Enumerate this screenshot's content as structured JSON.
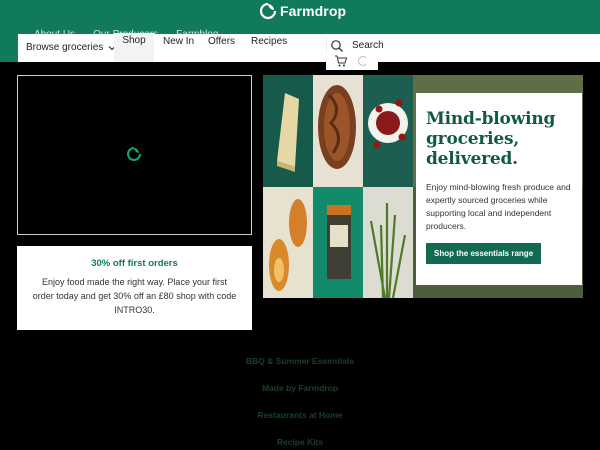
{
  "header": {
    "brand": "Farmdrop",
    "ghost_nav": [
      "About Us",
      "Our Producers",
      "Farmblog"
    ],
    "browse_label": "Browse groceries",
    "shop_label": "Shop",
    "menu": [
      "New In",
      "Offers",
      "Recipes"
    ],
    "search_label": "Search",
    "colors": {
      "brand_green": "#117a5d",
      "button_green": "#126a52"
    }
  },
  "promo": {
    "title": "30% off first orders",
    "body": "Enjoy food made the right way. Place your first order today and get 30% off an £80 shop with code INTRO30."
  },
  "hero": {
    "title": "Mind-blowing groceries, delivered.",
    "text": "Enjoy mind-blowing fresh produce and expertly sourced groceries while supporting local and independent producers.",
    "button": "Shop the essentials range"
  },
  "footer_links": [
    "BBQ & Summer Essentials",
    "Made by Farmdrop",
    "Restaurants at Home",
    "Recipe Kits"
  ]
}
